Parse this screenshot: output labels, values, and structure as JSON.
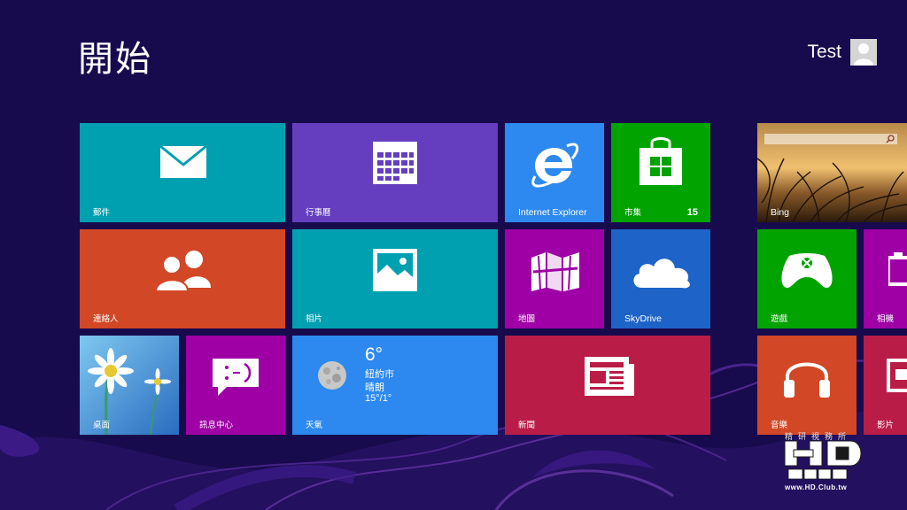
{
  "start": {
    "title": "開始"
  },
  "user": {
    "name": "Test"
  },
  "tiles": {
    "mail": {
      "label": "郵件",
      "color": "#00a0b1",
      "icon": "envelope-icon"
    },
    "calendar": {
      "label": "行事曆",
      "color": "#643ebf",
      "icon": "calendar-icon"
    },
    "ie": {
      "label": "Internet Explorer",
      "color": "#2d89ef",
      "icon": "internet-explorer-icon"
    },
    "store": {
      "label": "市集",
      "badge": "15",
      "color": "#00a300",
      "icon": "shopping-bag-icon"
    },
    "bing": {
      "label": "Bing",
      "icon": "bing-search-box-icon"
    },
    "people": {
      "label": "連絡人",
      "color": "#d24726",
      "icon": "people-icon"
    },
    "photos": {
      "label": "相片",
      "color": "#00a0b1",
      "icon": "photo-icon"
    },
    "maps": {
      "label": "地圖",
      "color": "#9e00a6",
      "icon": "map-icon"
    },
    "skydrive": {
      "label": "SkyDrive",
      "color": "#1e64c8",
      "icon": "cloud-icon"
    },
    "games": {
      "label": "遊戲",
      "color": "#00a300",
      "icon": "xbox-controller-icon"
    },
    "camera": {
      "label": "相機",
      "color": "#9e00a6",
      "icon": "camera-icon"
    },
    "desktop": {
      "label": "桌面",
      "icon": "daisy-wallpaper-icon"
    },
    "messaging": {
      "label": "訊息中心",
      "color": "#9e00a6",
      "icon": "chat-bubble-icon"
    },
    "weather": {
      "label": "天氣",
      "color": "#2d89ef",
      "icon": "moon-icon",
      "temp": "6°",
      "city": "紐約市",
      "condition": "晴朗",
      "range": "15°/1°"
    },
    "news": {
      "label": "新聞",
      "color": "#b91d47",
      "icon": "newspaper-icon"
    },
    "music": {
      "label": "音樂",
      "color": "#d24726",
      "icon": "headphones-icon"
    },
    "video": {
      "label": "影片",
      "color": "#b91d47",
      "icon": "video-icon"
    }
  },
  "watermark": {
    "top_text": "精研視務所",
    "logo_text": "HD CLUB",
    "url": "www.HD.Club.tw"
  }
}
